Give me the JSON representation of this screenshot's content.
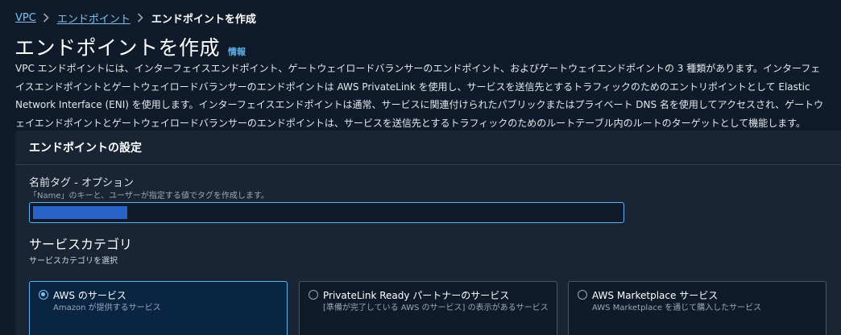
{
  "breadcrumb": {
    "items": [
      "VPC",
      "エンドポイント"
    ],
    "current": "エンドポイントを作成"
  },
  "header": {
    "title": "エンドポイントを作成",
    "info_link": "情報"
  },
  "description": "VPC エンドポイントには、インターフェイスエンドポイント、ゲートウェイロードバランサーのエンドポイント、およびゲートウェイエンドポイントの 3 種類があります。インターフェイスエンドポイントとゲートウェイロードバランサーのエンドポイントは AWS PrivateLink を使用し、サービスを送信先とするトラフィックのためのエントリポイントとして Elastic Network Interface (ENI) を使用します。インターフェイスエンドポイントは通常、サービスに関連付けられたパブリックまたはプライベート DNS 名を使用してアクセスされ、ゲートウェイエンドポイントとゲートウェイロードバランサーのエンドポイントは、サービスを送信先とするトラフィックのためのルートテーブル内のルートのターゲットとして機能します。",
  "panel": {
    "title": "エンドポイントの設定",
    "name_tag": {
      "label": "名前タグ - オプション",
      "description": "「Name」のキーと、ユーザーが指定する値でタグを作成します。",
      "value": ""
    },
    "service_category": {
      "heading": "サービスカテゴリ",
      "description": "サービスカテゴリを選択",
      "options": [
        {
          "title": "AWS のサービス",
          "description": "Amazon が提供するサービス",
          "selected": true
        },
        {
          "title": "PrivateLink Ready パートナーのサービス",
          "description": "[準備が完了している AWS のサービス] の表示があるサービス",
          "selected": false
        },
        {
          "title": "AWS Marketplace サービス",
          "description": "AWS Marketplace を通じて購入したサービス",
          "selected": false
        }
      ]
    }
  },
  "icons": {
    "breadcrumb_separator": "chevron-right-icon",
    "radio": "radio-icon"
  },
  "colors": {
    "background": "#0f1b2a",
    "panel": "#192534",
    "link": "#7ec1f0",
    "accent": "#5fb4f0",
    "selected_tile": "#0a2541"
  }
}
